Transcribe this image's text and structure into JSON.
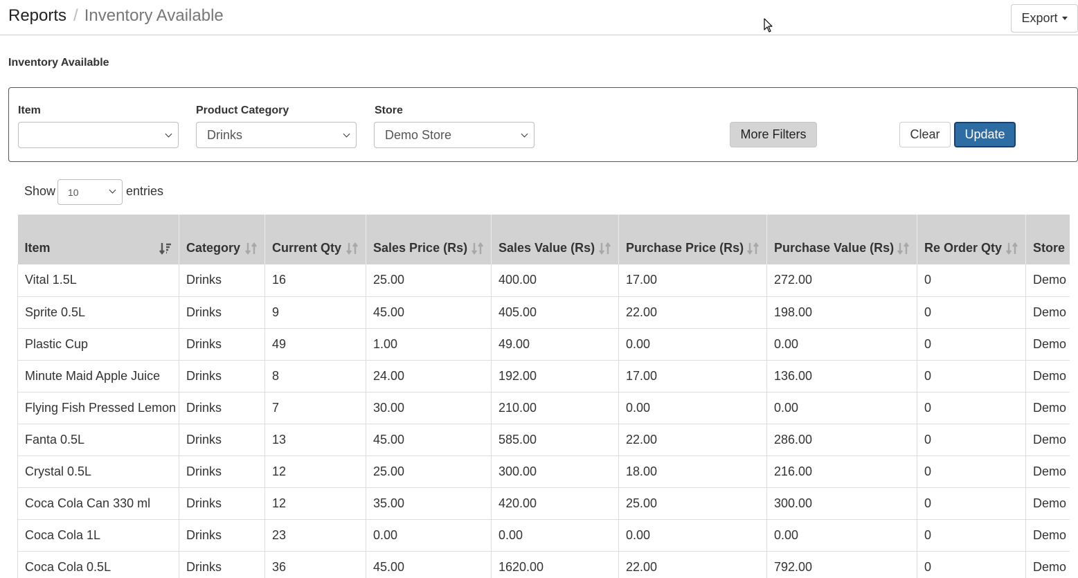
{
  "breadcrumb": {
    "root": "Reports",
    "separator": "/",
    "current": "Inventory Available"
  },
  "export_button": {
    "label": "Export"
  },
  "section_title": "Inventory Available",
  "filters": {
    "item": {
      "label": "Item",
      "value": ""
    },
    "category": {
      "label": "Product Category",
      "value": "Drinks"
    },
    "store": {
      "label": "Store",
      "value": "Demo Store"
    },
    "more_filters": "More Filters",
    "clear": "Clear",
    "update": "Update"
  },
  "length": {
    "show": "Show",
    "value": "10",
    "entries": "entries"
  },
  "table": {
    "columns": [
      "Item",
      "Category",
      "Current Qty",
      "Sales Price (Rs)",
      "Sales Value (Rs)",
      "Purchase Price (Rs)",
      "Purchase Value (Rs)",
      "Re Order Qty",
      "Store"
    ],
    "sorted_column": "Item",
    "rows": [
      [
        "Vital 1.5L",
        "Drinks",
        "16",
        "25.00",
        "400.00",
        "17.00",
        "272.00",
        "0",
        "Demo Store"
      ],
      [
        "Sprite 0.5L",
        "Drinks",
        "9",
        "45.00",
        "405.00",
        "22.00",
        "198.00",
        "0",
        "Demo Store"
      ],
      [
        "Plastic Cup",
        "Drinks",
        "49",
        "1.00",
        "49.00",
        "0.00",
        "0.00",
        "0",
        "Demo Store"
      ],
      [
        "Minute Maid Apple Juice",
        "Drinks",
        "8",
        "24.00",
        "192.00",
        "17.00",
        "136.00",
        "0",
        "Demo Store"
      ],
      [
        "Flying Fish Pressed Lemon",
        "Drinks",
        "7",
        "30.00",
        "210.00",
        "0.00",
        "0.00",
        "0",
        "Demo Store"
      ],
      [
        "Fanta 0.5L",
        "Drinks",
        "13",
        "45.00",
        "585.00",
        "22.00",
        "286.00",
        "0",
        "Demo Store"
      ],
      [
        "Crystal 0.5L",
        "Drinks",
        "12",
        "25.00",
        "300.00",
        "18.00",
        "216.00",
        "0",
        "Demo Store"
      ],
      [
        "Coca Cola Can 330 ml",
        "Drinks",
        "12",
        "35.00",
        "420.00",
        "25.00",
        "300.00",
        "0",
        "Demo Store"
      ],
      [
        "Coca Cola 1L",
        "Drinks",
        "23",
        "0.00",
        "0.00",
        "0.00",
        "0.00",
        "0",
        "Demo Store"
      ],
      [
        "Coca Cola 0.5L",
        "Drinks",
        "36",
        "45.00",
        "1620.00",
        "22.00",
        "792.00",
        "0",
        "Demo Store"
      ]
    ]
  },
  "icons": {
    "sort": "sort-icon",
    "sorted": "sort-ascending-icon",
    "dropdown": "chevron-down-icon",
    "cursor": "mouse-pointer-icon"
  }
}
